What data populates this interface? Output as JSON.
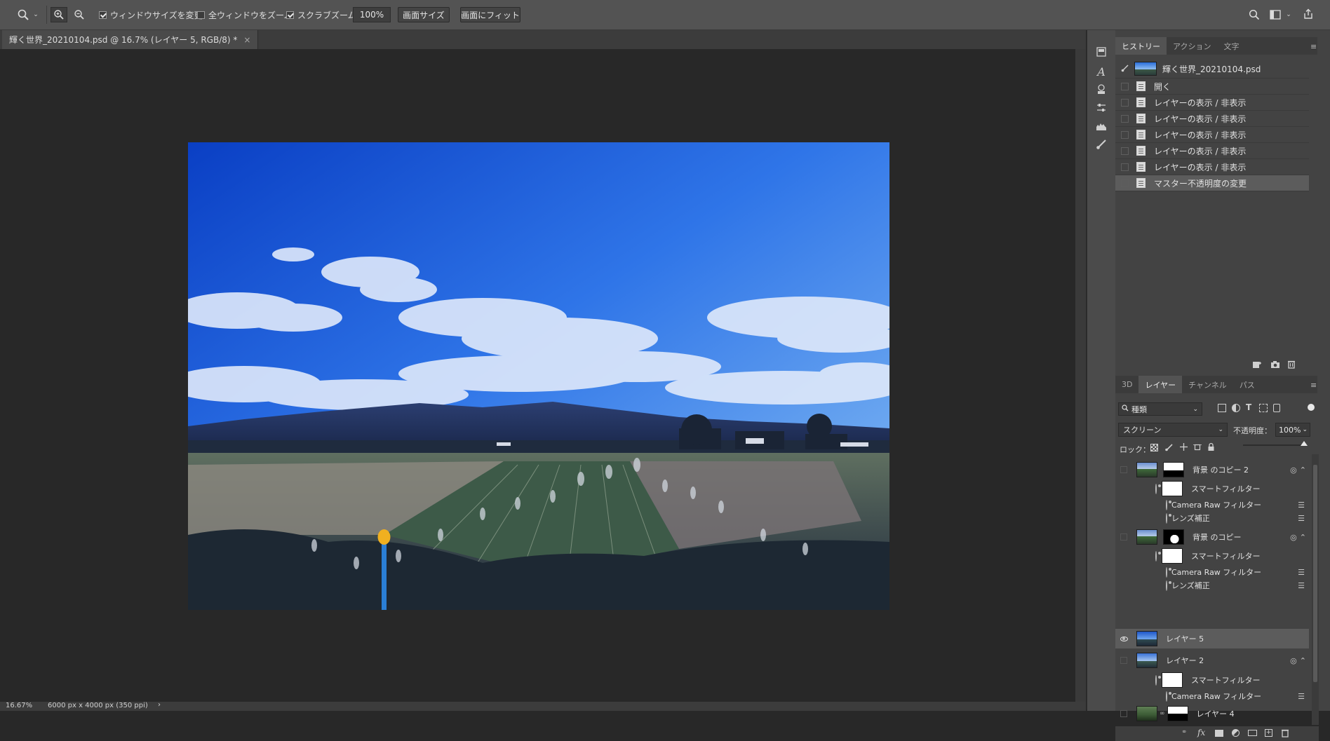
{
  "options": {
    "resize_windows": "ウィンドウサイズを変更",
    "zoom_all": "全ウィンドウをズーム",
    "scrubby_zoom": "スクラブズーム",
    "zoom_value": "100%",
    "fit_screen_btn": "画面サイズ",
    "fill_screen_btn": "画面にフィット"
  },
  "document": {
    "tab_title": "輝く世界_20210104.psd @ 16.7% (レイヤー 5, RGB/8) *",
    "close_glyph": "×"
  },
  "status": {
    "zoom": "16.67%",
    "doc_size": "6000 px x 4000 px (350 ppi)",
    "arrow": "›"
  },
  "history_panel": {
    "tabs": [
      "ヒストリー",
      "アクション",
      "文字"
    ],
    "snapshot_name": "輝く世界_20210104.psd",
    "items": [
      "開く",
      "レイヤーの表示 / 非表示",
      "レイヤーの表示 / 非表示",
      "レイヤーの表示 / 非表示",
      "レイヤーの表示 / 非表示",
      "レイヤーの表示 / 非表示",
      "マスター不透明度の変更"
    ]
  },
  "layers_panel": {
    "tabs": [
      "3D",
      "レイヤー",
      "チャンネル",
      "パス"
    ],
    "filter_kind": "種類",
    "blend_mode": "スクリーン",
    "opacity_label": "不透明度：",
    "opacity_value": "100%",
    "lock_label": "ロック：",
    "layers": [
      {
        "name": "背景 のコピー 2"
      },
      {
        "name": "スマートフィルター"
      },
      {
        "name": "Camera Raw フィルター"
      },
      {
        "name": "レンズ補正"
      },
      {
        "name": "背景 のコピー"
      },
      {
        "name": "スマートフィルター"
      },
      {
        "name": "Camera Raw フィルター"
      },
      {
        "name": "レンズ補正"
      },
      {
        "name": "レイヤー 5"
      },
      {
        "name": "レイヤー 2"
      },
      {
        "name": "スマートフィルター"
      },
      {
        "name": "Camera Raw フィルター"
      },
      {
        "name": "レイヤー 4"
      }
    ]
  },
  "colors": {
    "panel_bg": "#434343",
    "selected_row": "#5c5c5c",
    "options_bar": "#535353",
    "canvas_bg": "#282828"
  }
}
